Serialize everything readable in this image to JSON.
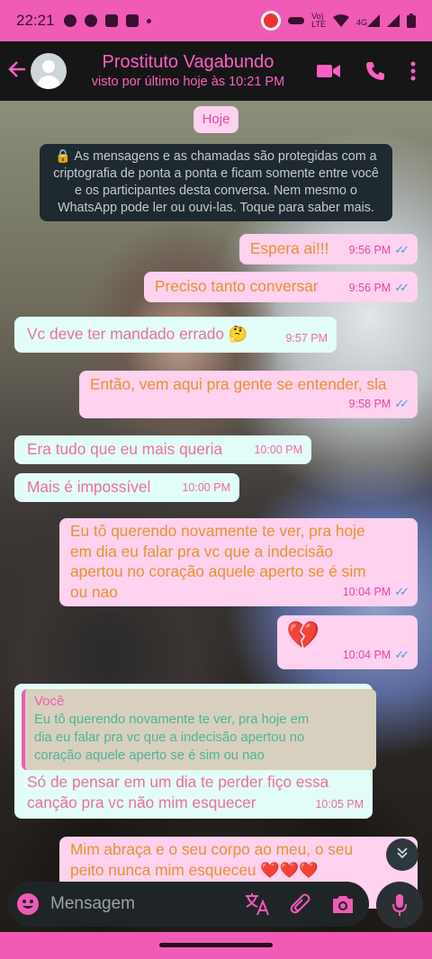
{
  "statusbar": {
    "time": "22:21",
    "network_label_top": "Vo)",
    "network_label_bottom": "LTE",
    "network_4g": "4G"
  },
  "header": {
    "contact_name": "Prostituto Vagabundo",
    "last_seen": "visto por último hoje às 10:21 PM"
  },
  "chat": {
    "date_chip": "Hoje",
    "encryption_notice": "🔒 As mensagens e as chamadas são protegidas com a criptografia de ponta a ponta e ficam somente entre você e os participantes desta conversa. Nem mesmo o WhatsApp pode ler ou ouvi-las. Toque para saber mais.",
    "messages": [
      {
        "direction": "out",
        "text": "Espera ai!!!",
        "time": "9:56 PM",
        "status": "read"
      },
      {
        "direction": "out",
        "text": "Preciso tanto conversar",
        "time": "9:56 PM",
        "status": "read"
      },
      {
        "direction": "in",
        "text": "Vc deve ter mandado errado 🤔",
        "time": "9:57 PM"
      },
      {
        "direction": "out",
        "text": "Então, vem aqui pra gente se entender, sla",
        "time": "9:58 PM",
        "status": "read"
      },
      {
        "direction": "in",
        "text": "Era tudo que eu mais queria",
        "time": "10:00 PM"
      },
      {
        "direction": "in",
        "text": "Mais é impossível",
        "time": "10:00 PM"
      },
      {
        "direction": "out",
        "text": "Eu tô querendo novamente te ver, pra hoje\nem dia eu falar pra vc que a indecisão\napertou no coração aquele aperto se é sim\nou nao",
        "time": "10:04 PM",
        "status": "read"
      },
      {
        "direction": "out",
        "text": "💔",
        "time": "10:04 PM",
        "status": "read"
      },
      {
        "direction": "in",
        "quote_author": "Você",
        "quote_text": "Eu tô querendo novamente te ver, pra hoje em\ndia eu falar pra vc que a indecisão apertou no\ncoração aquele aperto se é sim ou nao",
        "text": "Só de pensar em um dia te perder fiço essa\ncanção pra vc não mim esquecer",
        "time": "10:05 PM"
      },
      {
        "direction": "out",
        "text": "Mim abraça e o seu corpo ao meu, o seu\npeito nunca mim esqueceu ❤️❤️❤️",
        "time": "",
        "status": ""
      }
    ]
  },
  "composer": {
    "placeholder": "Mensagem"
  },
  "colors": {
    "accent": "#f05bb5",
    "outgoing_bubble": "#ffd2ef",
    "incoming_bubble": "#e2fdf7",
    "outgoing_text": "#e9932f",
    "incoming_text": "#ec6fa2",
    "read_ticks": "#3ea2e8"
  },
  "icons": [
    "back-arrow-icon",
    "video-call-icon",
    "phone-icon",
    "more-vert-icon",
    "emoji-icon",
    "translate-icon",
    "attach-icon",
    "camera-icon",
    "mic-icon",
    "scroll-down-icon"
  ]
}
